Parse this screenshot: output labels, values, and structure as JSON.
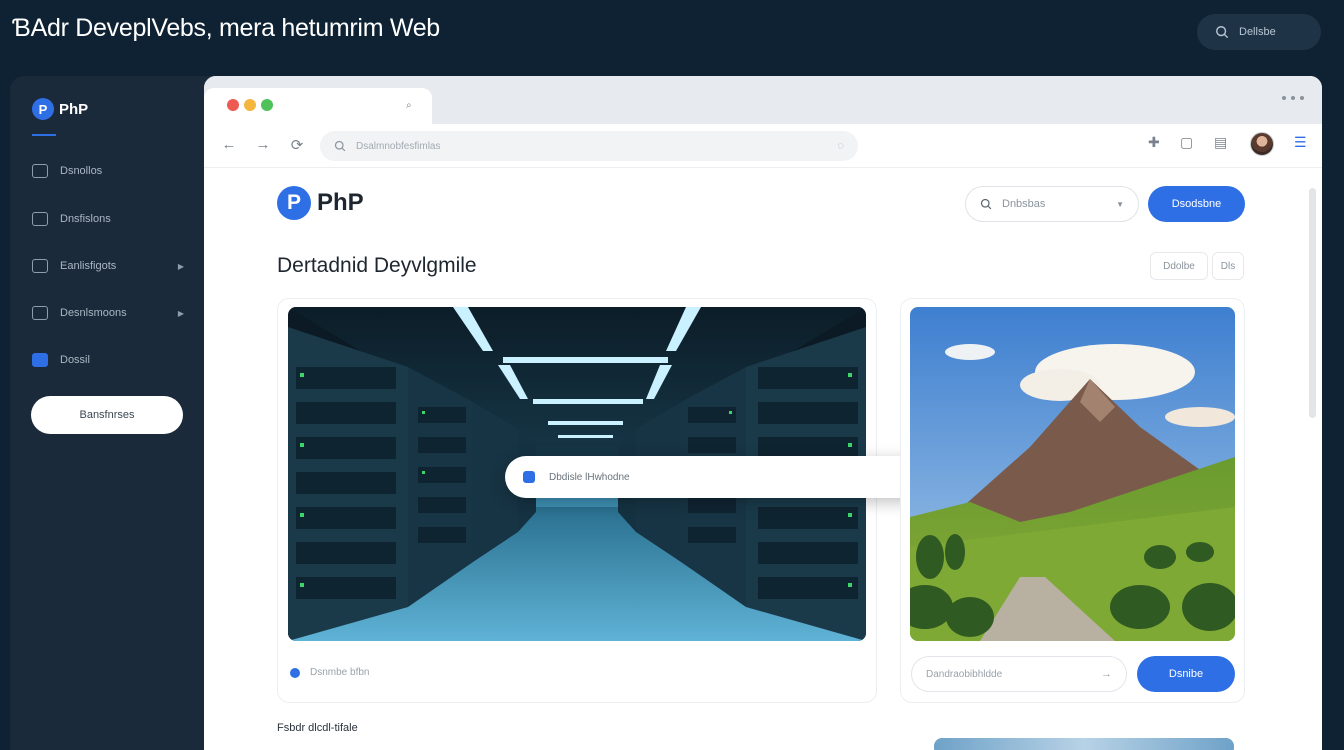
{
  "header": {
    "title": "ƁAdr DeveplVebs, mera hetumrim Web",
    "pill_label": "Dellsbe"
  },
  "sidebar": {
    "logo_text": "PhP",
    "items": [
      {
        "label": "Dsnollos",
        "has_chevron": false,
        "active": false
      },
      {
        "label": "Dnsfislons",
        "has_chevron": false,
        "active": false
      },
      {
        "label": "Eanlisfigots",
        "has_chevron": true,
        "active": false
      },
      {
        "label": "Desnlsmoons",
        "has_chevron": true,
        "active": false
      },
      {
        "label": "Dossil",
        "has_chevron": false,
        "active": true
      }
    ],
    "button_label": "Bansfnrses"
  },
  "browser": {
    "url_placeholder": "Dsalmnobfesfimlas",
    "page": {
      "logo_text": "PhP",
      "search_placeholder": "Dnbsbas",
      "primary_button": "Dsodsbne",
      "section_title": "Dertadnid Deyvlgmile",
      "mini_buttons": [
        "Ddolbe",
        "Dls"
      ],
      "overlay_text": "Dbdisle lHwhodne",
      "card_footer_text": "Dsnmbe bfbn",
      "right_input_placeholder": "Dandraobibhldde",
      "right_button": "Dsnibe",
      "bottom_label": "Fsbdr dlcdl-tifale"
    }
  },
  "colors": {
    "background": "#0f2233",
    "sidebar": "#1b2a3a",
    "accent": "#2f6fe6"
  }
}
